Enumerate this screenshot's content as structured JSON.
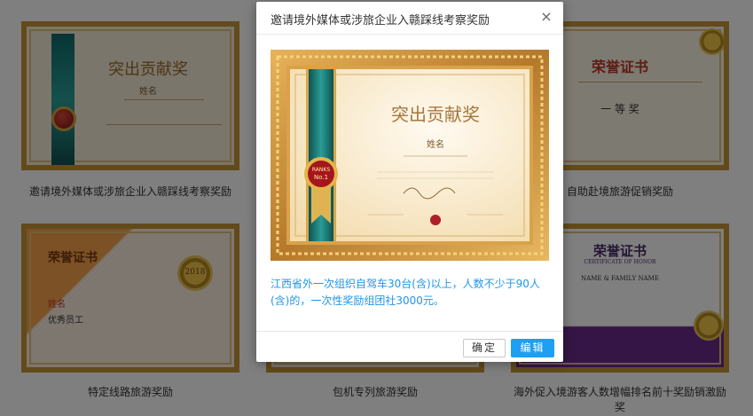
{
  "cards": [
    {
      "caption": "邀请境外媒体或涉旅企业入赣踩线考察奖励",
      "cert_title": "突出贡献奖",
      "cert_name": "姓名"
    },
    {
      "caption": "自助赴境旅游促销奖励",
      "cert_title": "荣誉证书",
      "cert_subtitle": "一 等 奖"
    },
    {
      "caption": "特定线路旅游奖励",
      "cert_title": "荣誉证书",
      "cert_name": "姓名",
      "cert_role": "优秀员工",
      "cert_year": "2018"
    },
    {
      "caption": "包机专列旅游奖励"
    },
    {
      "caption": "海外促入境游客人数增幅排名前十奖励销激励奖",
      "cert_title": "荣誉证书",
      "cert_en": "CERTIFICATE OF HONOR",
      "cert_name": "NAME & FAMILY NAME"
    }
  ],
  "modal": {
    "title": "邀请境外媒体或涉旅企业入赣踩线考察奖励",
    "close": "×",
    "preview": {
      "cert_title": "突出贡献奖",
      "cert_name": "姓名",
      "medal_text": "No.1"
    },
    "description": "江西省外一次组织自驾车30台(含)以上，人数不少于90人(含)的，一次性奖励组团社3000元。",
    "ok_label": "确定",
    "edit_label": "编辑"
  },
  "colors": {
    "accent": "#1e9ff2",
    "link_text": "#2196e8",
    "overlay": "rgba(0,0,0,0.5)"
  },
  "icons": {
    "close": "close-icon",
    "medal": "medal-icon",
    "rosette": "rosette-icon"
  }
}
